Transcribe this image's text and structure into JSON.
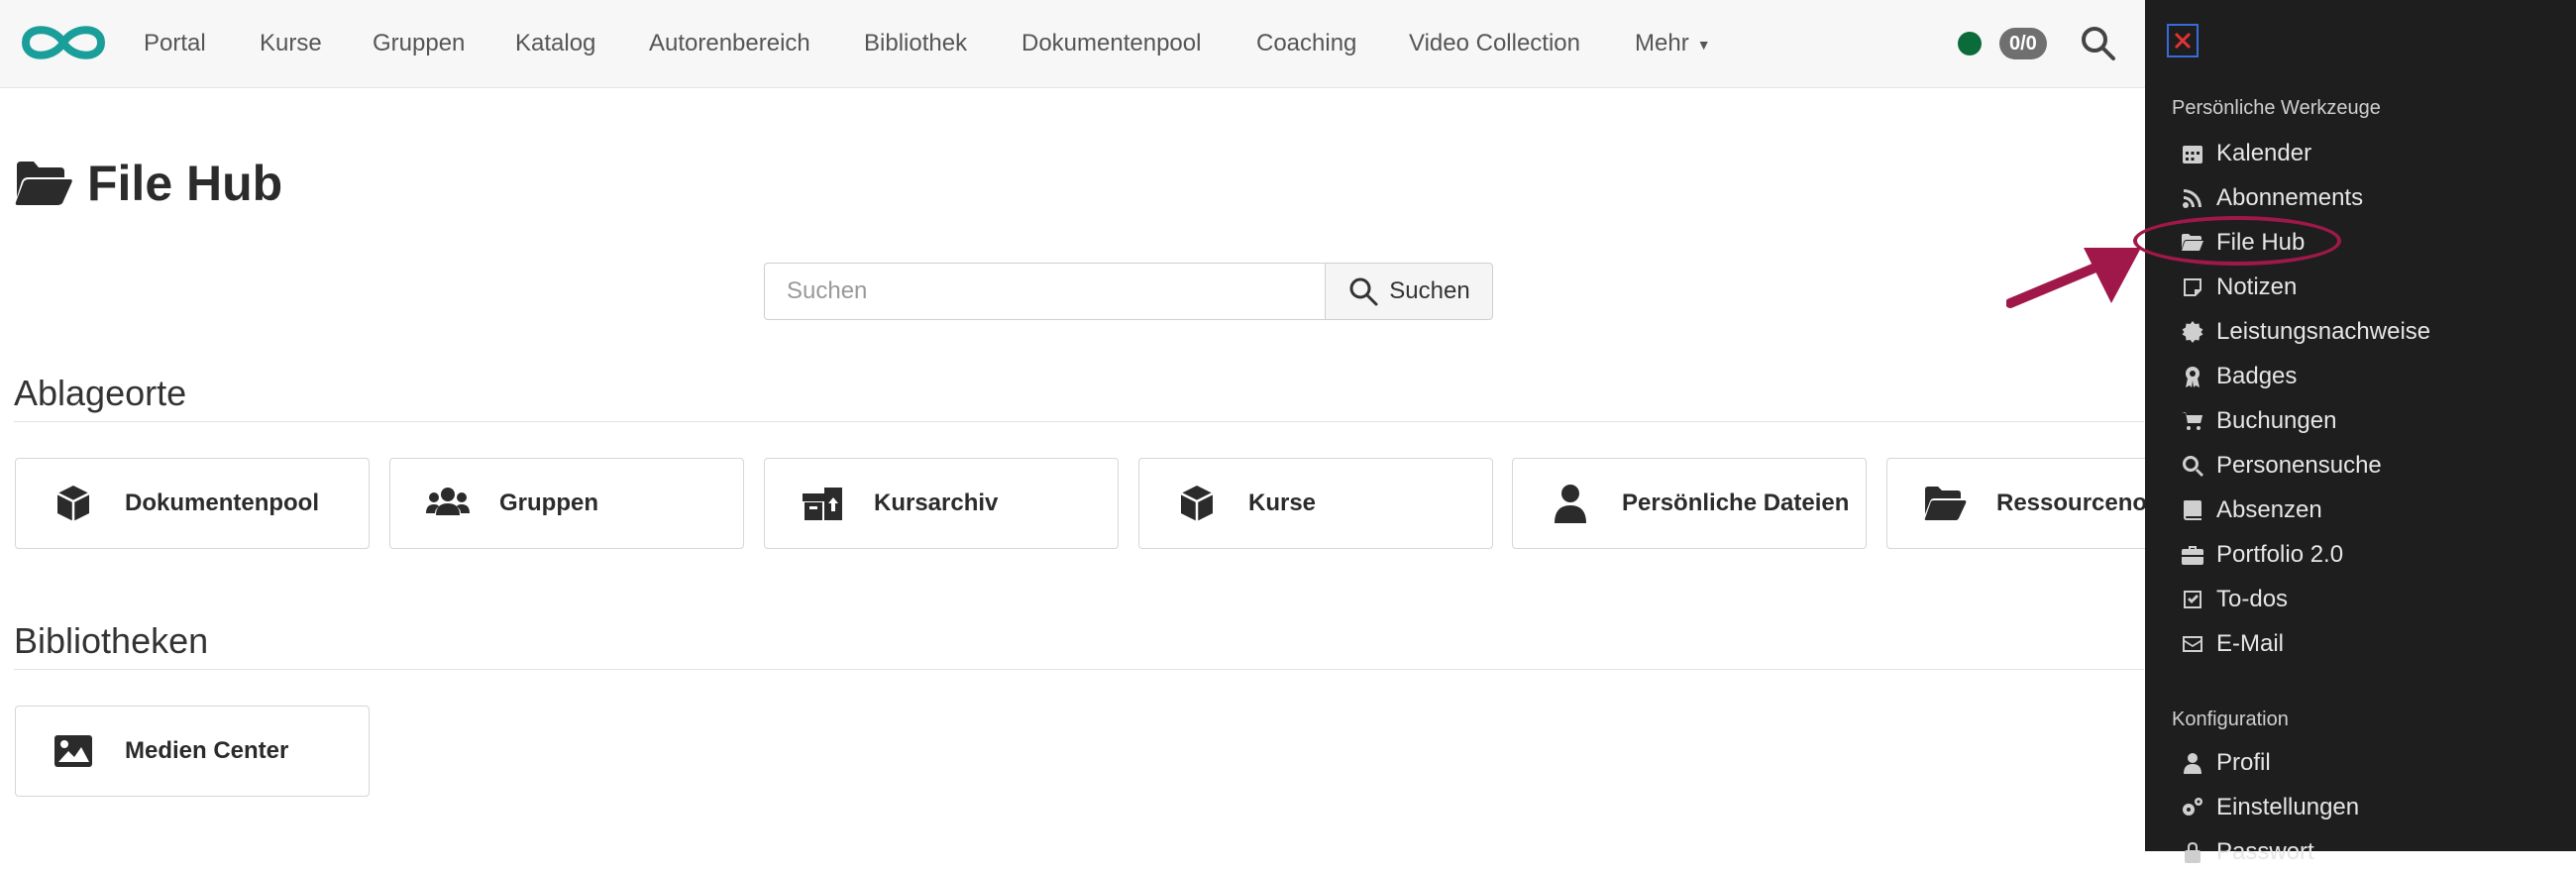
{
  "nav": {
    "items": [
      "Portal",
      "Kurse",
      "Gruppen",
      "Katalog",
      "Autorenbereich",
      "Bibliothek",
      "Dokumentenpool",
      "Coaching",
      "Video Collection"
    ],
    "more_label": "Mehr",
    "counter": "0/0",
    "status_color": "#0b6b3a"
  },
  "page": {
    "title": "File Hub",
    "search_placeholder": "Suchen",
    "search_button": "Suchen"
  },
  "sections": {
    "locations_title": "Ablageorte",
    "locations": [
      "Dokumentenpool",
      "Gruppen",
      "Kursarchiv",
      "Kurse",
      "Persönliche Dateien",
      "Ressourcenorte"
    ],
    "libraries_title": "Bibliotheken",
    "libraries": [
      "Medien Center"
    ]
  },
  "panel": {
    "tools_heading": "Persönliche Werkzeuge",
    "tools": [
      "Kalender",
      "Abonnements",
      "File Hub",
      "Notizen",
      "Leistungsnachweise",
      "Badges",
      "Buchungen",
      "Personensuche",
      "Absenzen",
      "Portfolio 2.0",
      "To-dos",
      "E-Mail"
    ],
    "config_heading": "Konfiguration",
    "config": [
      "Profil",
      "Einstellungen",
      "Passwort"
    ]
  },
  "colors": {
    "brand": "#1a9e9a",
    "panel_bg": "#1e1e1e",
    "highlight": "#a0184a",
    "close_border": "#3a6bd8"
  }
}
